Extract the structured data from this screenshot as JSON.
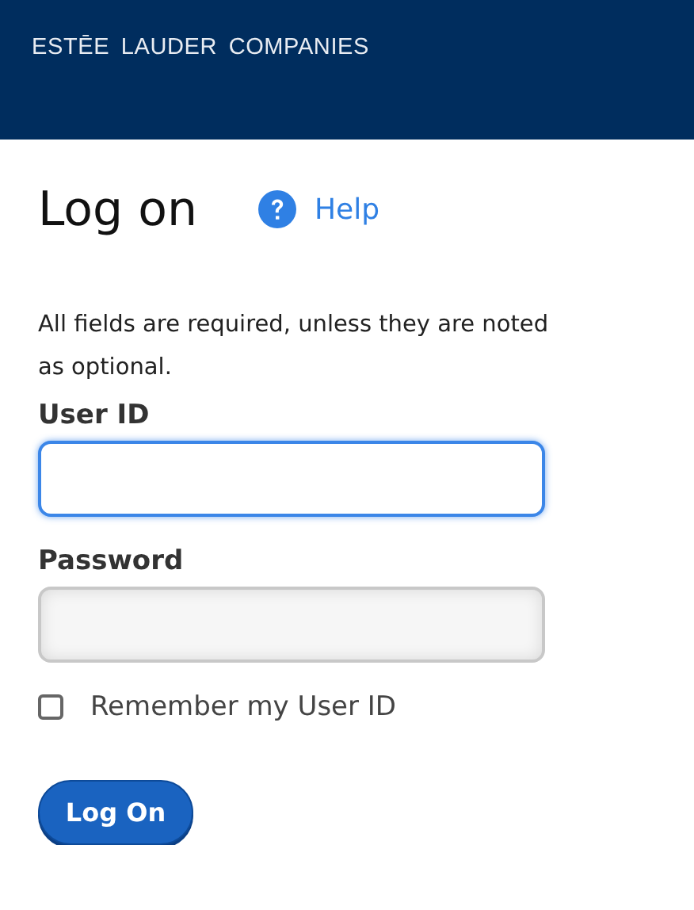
{
  "header": {
    "logo": "ESTĒE LAUDER COMPANIES"
  },
  "title": "Log on",
  "help_link": "Help",
  "intro": "All fields are required, unless they are noted as optional.",
  "fields": [
    {
      "label": "User ID",
      "focused": true
    },
    {
      "label": "Password",
      "focused": false
    }
  ],
  "remember": {
    "label": "Remember my User ID",
    "checked": false
  },
  "submit_button": "Log On"
}
